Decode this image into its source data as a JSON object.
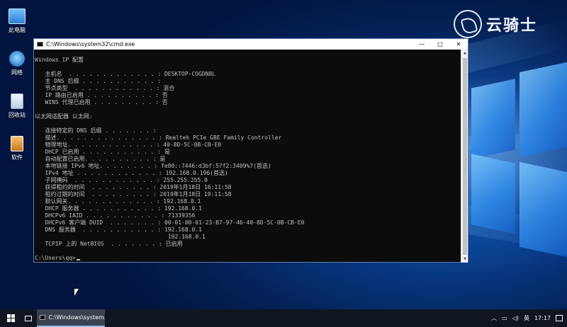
{
  "desktop": {
    "icons": [
      {
        "label": "此电脑",
        "color": "#4aa3e8"
      },
      {
        "label": "网络",
        "color": "#3f8fd6"
      },
      {
        "label": "回收站",
        "color": "#d8e6f2"
      },
      {
        "label": "软件",
        "color": "#e6a23c"
      }
    ],
    "brand": "云骑士"
  },
  "cmd_window": {
    "title": "C:\\Windows\\system32\\cmd.exe",
    "minimize": "—",
    "maximize": "□",
    "close": "✕",
    "lines": [
      "Windows IP 配置",
      "",
      "   主机名  . . . . . . . . . . . . . : DESKTOP-COGDN8L",
      "   主 DNS 后缀 . . . . . . . . . . . :",
      "   节点类型  . . . . . . . . . . . . : 混合",
      "   IP 路由已启用 . . . . . . . . . . : 否",
      "   WINS 代理已启用 . . . . . . . . . : 否",
      "",
      "以太网适配器 以太网:",
      "",
      "   连接特定的 DNS 后缀 . . . . . . . :",
      "   描述. . . . . . . . . . . . . . . : Realtek PCIe GBE Family Controller",
      "   物理地址. . . . . . . . . . . . . : 40-8D-5C-0B-CB-E0",
      "   DHCP 已启用 . . . . . . . . . . . : 是",
      "   自动配置已启用. . . . . . . . . . : 是",
      "   本地链接 IPv6 地址. . . . . . . . : fe80::7446:d3bf:57f2:3409%7(首选)",
      "   IPv4 地址 . . . . . . . . . . . . : 192.168.0.196(首选)",
      "   子网掩码  . . . . . . . . . . . . : 255.255.255.0",
      "   获得租约的时间  . . . . . . . . . : 2019年1月18日 16:11:58",
      "   租约过期的时间  . . . . . . . . . : 2019年1月18日 19:11:58",
      "   默认网关. . . . . . . . . . . . . : 192.168.0.1",
      "   DHCP 服务器 . . . . . . . . . . . : 192.168.0.1",
      "   DHCPv6 IAID . . . . . . . . . . . : 71339356",
      "   DHCPv6 客户端 DUID  . . . . . . . : 00-01-00-01-23-B7-97-46-40-8D-5C-0B-CB-E0",
      "   DNS 服务器  . . . . . . . . . . . : 192.168.0.1",
      "                                       192.168.0.1",
      "   TCPIP 上的 NetBIOS  . . . . . . . : 已启用",
      ""
    ],
    "prompt": "C:\\Users\\qq>"
  },
  "taskbar": {
    "app_label": "C:\\Windows\\system...",
    "tray_ime": "英",
    "clock": "17:17"
  }
}
